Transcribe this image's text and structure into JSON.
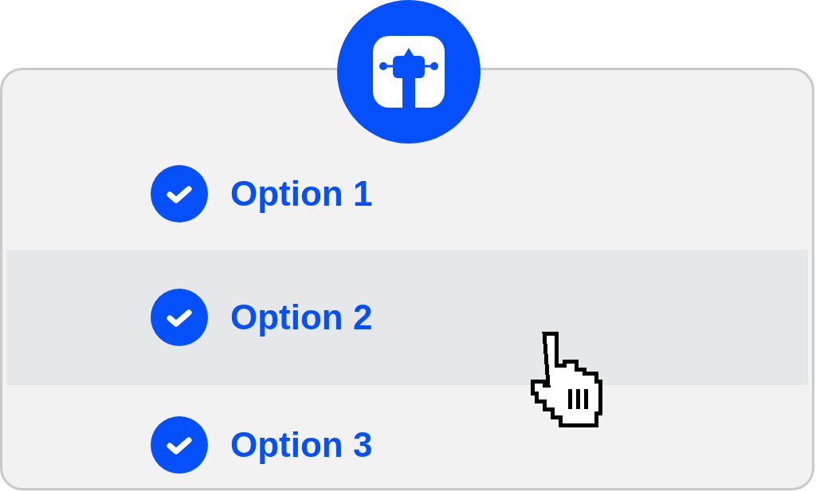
{
  "options": [
    {
      "label": "Option 1",
      "checked": true,
      "hovered": false
    },
    {
      "label": "Option 2",
      "checked": true,
      "hovered": true
    },
    {
      "label": "Option 3",
      "checked": true,
      "hovered": false
    }
  ]
}
